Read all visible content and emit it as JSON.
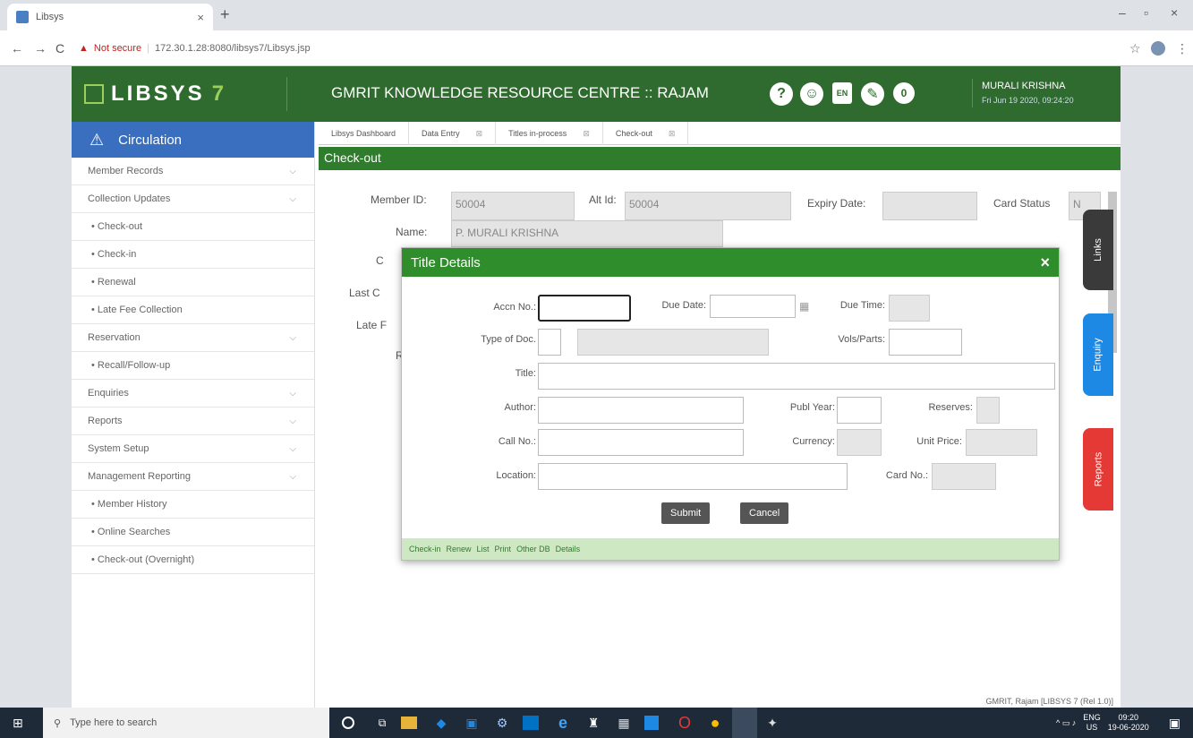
{
  "browser": {
    "tab_title": "Libsys",
    "tab_close": "×",
    "new_tab": "+",
    "not_secure": "Not secure",
    "url": "172.30.1.28:8080/libsys7/Libsys.jsp",
    "back": "←",
    "forward": "→",
    "reload": "C",
    "star": "☆",
    "menu": "⋮",
    "min": "–",
    "max": "▫",
    "close": "×"
  },
  "header": {
    "logo_text": "LIBSYS",
    "logo_seven": "7",
    "institution": "GMRIT KNOWLEDGE RESOURCE CENTRE :: RAJAM",
    "icons": [
      "help-icon",
      "support-icon",
      "language-icon",
      "tools-icon",
      "notifications-icon"
    ],
    "help_glyph": "?",
    "support_glyph": "☺",
    "language_glyph": "EN",
    "tools_glyph": "✎",
    "notification_count": "0",
    "user_name": "MURALI KRISHNA",
    "user_datetime": "Fri Jun 19 2020, 09:24:20"
  },
  "sidebar": {
    "title": "Circulation",
    "title_glyph": "⚠",
    "chevron": "⌵",
    "items": [
      {
        "label": "Member Records",
        "type": "group"
      },
      {
        "label": "Collection Updates",
        "type": "group"
      },
      {
        "label": "• Check-out",
        "type": "sub"
      },
      {
        "label": "• Check-in",
        "type": "sub"
      },
      {
        "label": "• Renewal",
        "type": "sub"
      },
      {
        "label": "• Late Fee Collection",
        "type": "sub"
      },
      {
        "label": "Reservation",
        "type": "group"
      },
      {
        "label": "• Recall/Follow-up",
        "type": "sub"
      },
      {
        "label": "Enquiries",
        "type": "group"
      },
      {
        "label": "Reports",
        "type": "group"
      },
      {
        "label": "System Setup",
        "type": "group"
      },
      {
        "label": "Management Reporting",
        "type": "group"
      },
      {
        "label": "• Member History",
        "type": "sub"
      },
      {
        "label": "• Online Searches",
        "type": "sub"
      },
      {
        "label": "• Check-out (Overnight)",
        "type": "sub"
      }
    ]
  },
  "tabs": [
    {
      "label": "Libsys Dashboard",
      "close": ""
    },
    {
      "label": "Data Entry",
      "close": "⊠"
    },
    {
      "label": "Titles in-process",
      "close": "⊠"
    },
    {
      "label": "Check-out",
      "close": "⊠"
    }
  ],
  "page": {
    "title": "Check-out",
    "member_id_label": "Member ID:",
    "member_id": "50004",
    "alt_id_label": "Alt Id:",
    "alt_id": "50004",
    "expiry_label": "Expiry Date:",
    "card_status_label": "Card Status",
    "card_status_value": "N",
    "name_label": "Name:",
    "name_value": "P. MURALI  KRISHNA",
    "partial_labels": [
      "C",
      "Last C",
      "Late F",
      "R"
    ],
    "footer": "GMRIT, Rajam [LIBSYS 7 (Rel 1.0)]"
  },
  "side_tabs": {
    "links": "Links",
    "enquiry": "Enquiry",
    "reports": "Reports",
    "links_color": "#3a3a3a",
    "enquiry_color": "#1e88e5",
    "reports_color": "#e53935"
  },
  "modal": {
    "title": "Title Details",
    "close": "×",
    "accn_label": "Accn No.:",
    "due_date_label": "Due Date:",
    "due_time_label": "Due Time:",
    "type_label": "Type of Doc.",
    "vols_label": "Vols/Parts:",
    "title_label": "Title:",
    "author_label": "Author:",
    "publ_year_label": "Publ Year:",
    "reserves_label": "Reserves:",
    "call_no_label": "Call No.:",
    "currency_label": "Currency:",
    "unit_price_label": "Unit Price:",
    "location_label": "Location:",
    "card_no_label": "Card No.:",
    "submit": "Submit",
    "cancel": "Cancel",
    "calendar_glyph": "▦",
    "footer_links": [
      "Check-in",
      "Renew",
      "List",
      "Print",
      "Other DB",
      "Details"
    ]
  },
  "taskbar": {
    "search_placeholder": "Type here to search",
    "start_glyph": "⊞",
    "search_glyph": "⚲",
    "lang": "ENG",
    "region": "US",
    "time": "09:20",
    "date": "19-06-2020",
    "tray_glyphs": "^ ▭ ♪",
    "notif_glyph": "▣"
  }
}
